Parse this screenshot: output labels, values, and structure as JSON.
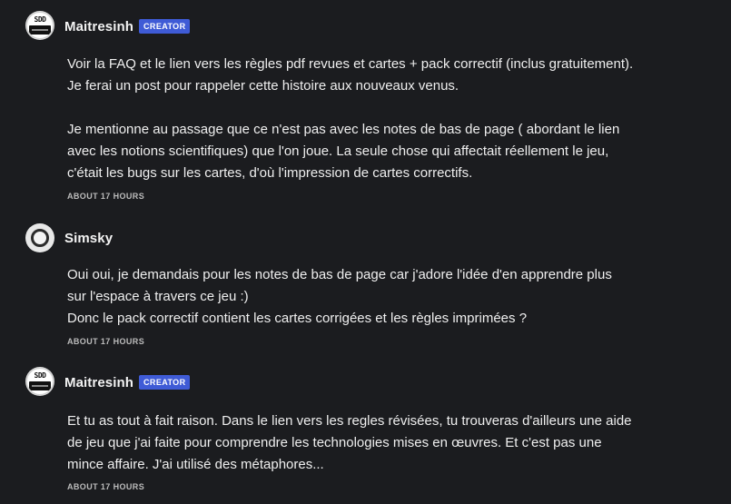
{
  "comments": [
    {
      "author": "Maitresinh",
      "badge": "CREATOR",
      "avatar_icon": "sdd-logo-avatar",
      "paragraphs": [
        "Voir la FAQ et le lien vers les règles pdf revues et cartes + pack correctif (inclus gratuitement).",
        "Je ferai un post pour rappeler cette histoire aux nouveaux venus.",
        "",
        "Je mentionne au passage que ce n'est pas avec les notes de bas de page ( abordant le lien",
        "avec les notions scientifiques) que l'on joue. La seule chose qui affectait réellement le jeu,",
        "c'était les bugs sur les cartes, d'où l'impression de cartes correctifs."
      ],
      "timestamp": "ABOUT 17 HOURS"
    },
    {
      "author": "Simsky",
      "badge": "",
      "avatar_icon": "ring-avatar",
      "paragraphs": [
        "Oui oui, je demandais pour les notes de bas de page car j'adore l'idée d'en apprendre plus",
        "sur l'espace à travers ce jeu :)",
        "Donc le pack correctif contient les cartes corrigées et les règles imprimées ?"
      ],
      "timestamp": "ABOUT 17 HOURS"
    },
    {
      "author": "Maitresinh",
      "badge": "CREATOR",
      "avatar_icon": "sdd-logo-avatar",
      "paragraphs": [
        "Et tu as tout à fait raison. Dans le lien vers les regles révisées, tu trouveras d'ailleurs une aide",
        "de jeu que j'ai faite pour comprendre les technologies mises en œuvres. Et c'est pas une",
        "mince affaire. J'ai utilisé des métaphores..."
      ],
      "timestamp": "ABOUT 17 HOURS"
    }
  ],
  "colors": {
    "background": "#1b1c1f",
    "text": "#efefef",
    "badge_bg": "#3f5bd6",
    "timestamp": "#bcbcbc"
  }
}
